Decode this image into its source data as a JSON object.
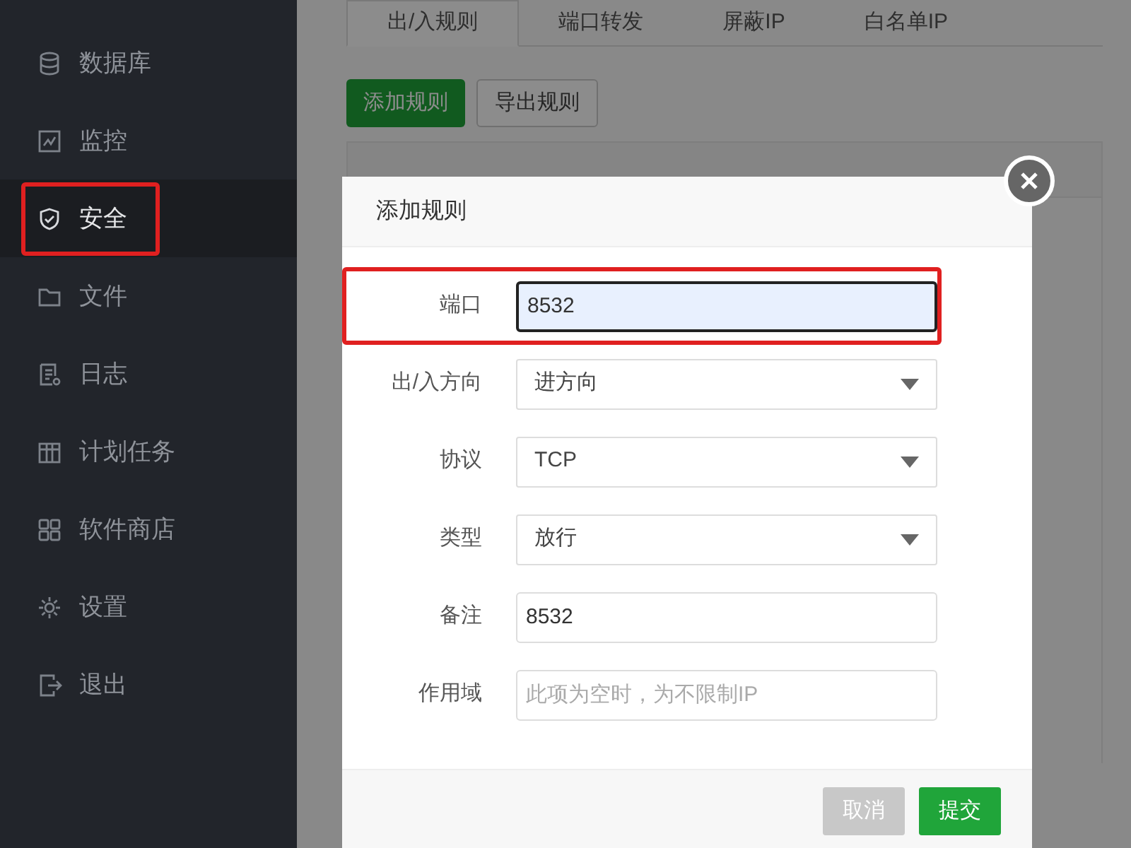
{
  "sidebar": {
    "items": [
      {
        "label": "数据库",
        "selected": false,
        "highlighted": false
      },
      {
        "label": "监控",
        "selected": false,
        "highlighted": false
      },
      {
        "label": "安全",
        "selected": true,
        "highlighted": true
      },
      {
        "label": "文件",
        "selected": false,
        "highlighted": false
      },
      {
        "label": "日志",
        "selected": false,
        "highlighted": false
      },
      {
        "label": "计划任务",
        "selected": false,
        "highlighted": false
      },
      {
        "label": "软件商店",
        "selected": false,
        "highlighted": false
      },
      {
        "label": "设置",
        "selected": false,
        "highlighted": false
      },
      {
        "label": "退出",
        "selected": false,
        "highlighted": false
      }
    ]
  },
  "tabs": [
    {
      "label": "出/入规则",
      "selected": true
    },
    {
      "label": "端口转发",
      "selected": false
    },
    {
      "label": "屏蔽IP",
      "selected": false
    },
    {
      "label": "白名单IP",
      "selected": false
    }
  ],
  "toolbar": [
    {
      "label": "添加规则",
      "kind": "primary"
    },
    {
      "label": "导出规则",
      "kind": "default"
    }
  ],
  "dialog": {
    "title": "添加规则",
    "fields": [
      {
        "label": "端口",
        "kind": "input",
        "value": "8532",
        "focused": true,
        "highlighted": true
      },
      {
        "label": "出/入方向",
        "kind": "select",
        "value": "进方向",
        "highlighted": false
      },
      {
        "label": "协议",
        "kind": "select",
        "value": "TCP",
        "highlighted": false
      },
      {
        "label": "类型",
        "kind": "select",
        "value": "放行",
        "highlighted": false
      },
      {
        "label": "备注",
        "kind": "input",
        "value": "8532",
        "focused": false,
        "highlighted": false
      },
      {
        "label": "作用域",
        "kind": "input",
        "placeholder": "此项为空时，为不限制IP",
        "focused": false,
        "highlighted": false
      }
    ],
    "buttons": [
      {
        "label": "取消",
        "kind": "default"
      },
      {
        "label": "提交",
        "kind": "primary"
      }
    ]
  }
}
